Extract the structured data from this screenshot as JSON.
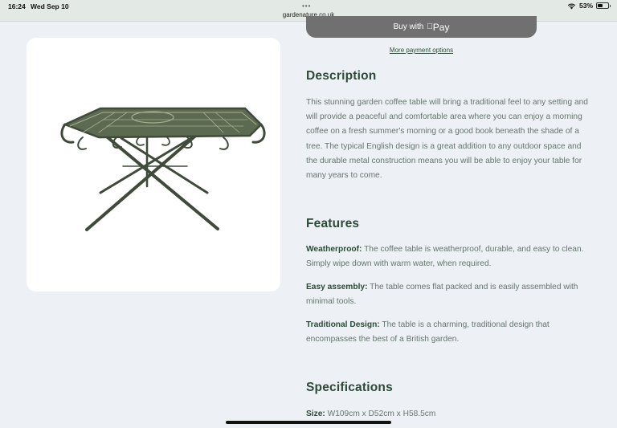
{
  "status_bar": {
    "time": "16:24",
    "date": "Wed Sep 10",
    "url": "gardenature.co.uk",
    "battery_percent": "53%",
    "battery_level": 0.53
  },
  "product_image": {
    "icon": "garden-coffee-table-image"
  },
  "payment": {
    "buy_with_label": "Buy with",
    "pay_label": "Pay",
    "more_options": "More payment options"
  },
  "description": {
    "heading": "Description",
    "text": "This stunning garden coffee table will bring a traditional feel to any setting and will provide a peaceful and comfortable area where you can enjoy a morning coffee on a fresh summer's morning or a good book beneath the shade of a tree. The typical English design is a great addition to any outdoor space and the durable metal construction means you will be able to enjoy your table for many years to come."
  },
  "features": {
    "heading": "Features",
    "items": [
      {
        "label": "Weatherproof:",
        "text": " The coffee table is weatherproof, durable, and easy to clean. Simply wipe down with warm water, when required."
      },
      {
        "label": "Easy assembly:",
        "text": " The table comes flat packed and is easily assembled with minimal tools."
      },
      {
        "label": "Traditional Design:",
        "text": " The table is a charming, traditional design that encompasses the best of a British garden."
      }
    ]
  },
  "specifications": {
    "heading": "Specifications",
    "items": [
      {
        "label": "Size:",
        "text": " W109cm x D52cm x H58.5cm"
      }
    ]
  },
  "colors": {
    "heading": "#2c4a37",
    "body_text": "#65756d",
    "page_bg": "#edf0f4",
    "pay_button": "#707070"
  }
}
